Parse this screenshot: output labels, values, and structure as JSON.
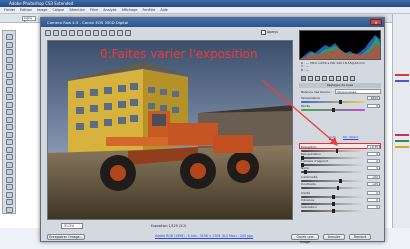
{
  "app": {
    "title": "Adobe Photoshop CS3 Extended",
    "menu": [
      "Fichier",
      "Edition",
      "Image",
      "Calque",
      "Sélection",
      "Filtre",
      "Analyse",
      "Affichage",
      "Fenêtre",
      "Aide"
    ],
    "options_field": "Ligne 1"
  },
  "dialog": {
    "title": "Camera Raw 4.5 - Canon EOS 350D Digital",
    "preview_label": "Aperçu",
    "zoom": "31.2%",
    "file_info": "Exposition 1/125 (3:2)",
    "workflow_link": "Adobe RGB (1998) ; 8 bits ; 3456 × 2304 (8,0 Mpx) ; 240 ppp",
    "buttons": {
      "save": "Enregistrer l'image...",
      "open": "Ouvrir une image",
      "cancel": "Annuler",
      "done": "Terminé"
    }
  },
  "readout": {
    "r": "R : --- ",
    "g": "V : --- ",
    "b": "B : --- ",
    "exif": "f/8,0  1/250 s  ISO 100  18-55@18 mm"
  },
  "panel": {
    "section": "Réglages de base",
    "white_balance_label": "Balance des blancs :",
    "white_balance_value": "Personnalisée",
    "auto_link": "Auto",
    "default_link": "Par défaut",
    "sliders": [
      {
        "label": "Température",
        "value": "6500",
        "level": 0.62,
        "track": "blue-yellow"
      },
      {
        "label": "Teinte",
        "value": "0",
        "level": 0.5,
        "track": "green-magenta"
      },
      {
        "label": "Exposition",
        "value": "+0,35",
        "level": 0.56,
        "track": "gray"
      },
      {
        "label": "Récupération",
        "value": "0",
        "level": 0.0,
        "track": "gray"
      },
      {
        "label": "Lumière d'appoint",
        "value": "0",
        "level": 0.0,
        "track": "gray"
      },
      {
        "label": "Noirs",
        "value": "5",
        "level": 0.05,
        "track": "gray"
      },
      {
        "label": "Luminosité",
        "value": "+50",
        "level": 0.62,
        "track": "gray"
      },
      {
        "label": "Contraste",
        "value": "+25",
        "level": 0.58,
        "track": "gray"
      },
      {
        "label": "Clarté",
        "value": "0",
        "level": 0.5,
        "track": "gray"
      },
      {
        "label": "Vibrance",
        "value": "0",
        "level": 0.5,
        "track": "gray"
      },
      {
        "label": "Saturation",
        "value": "0",
        "level": 0.5,
        "track": "gray"
      }
    ]
  },
  "annotation": "0:Faites varier l'exposition",
  "colors": {
    "annotation": "#f03a3a",
    "accent": "#2b548e",
    "link": "#2b4fd8"
  }
}
